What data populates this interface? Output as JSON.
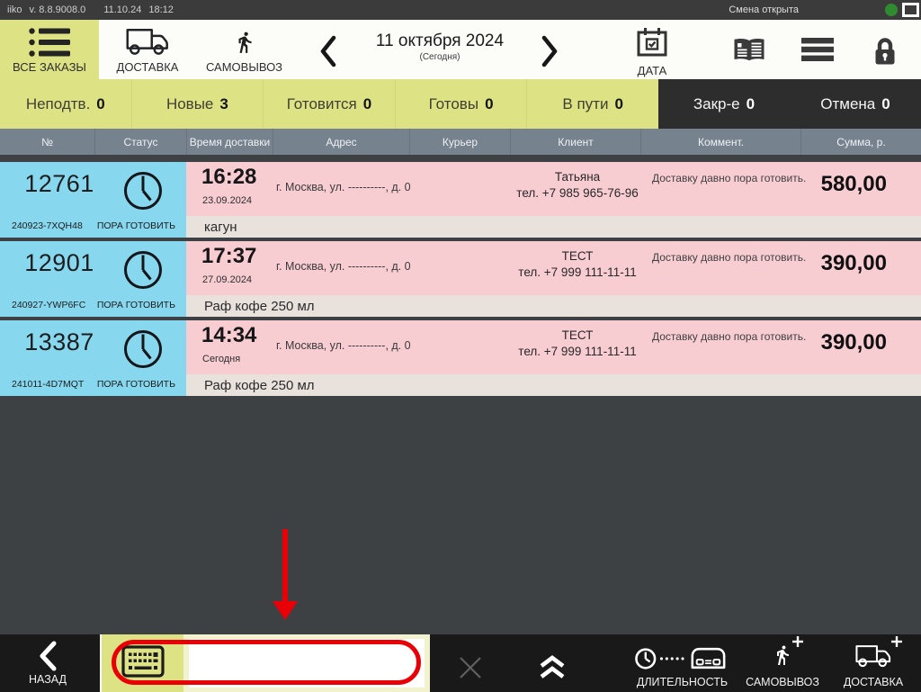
{
  "window": {
    "app": "iiko",
    "version": "v. 8.8.9008.0",
    "date": "11.10.24",
    "time": "18:12",
    "shift_status": "Смена открыта"
  },
  "toolbar": {
    "all_orders": "ВСЕ ЗАКАЗЫ",
    "delivery": "ДОСТАВКА",
    "pickup": "САМОВЫВОЗ",
    "date_title": "11 октября 2024",
    "date_subtitle": "(Сегодня)",
    "date_button": "ДАТА"
  },
  "filters": {
    "unconfirmed_label": "Неподтв.",
    "unconfirmed_count": "0",
    "new_label": "Новые",
    "new_count": "3",
    "preparing_label": "Готовится",
    "preparing_count": "0",
    "ready_label": "Готовы",
    "ready_count": "0",
    "on_way_label": "В пути",
    "on_way_count": "0",
    "closed_label": "Закр-е",
    "closed_count": "0",
    "cancelled_label": "Отмена",
    "cancelled_count": "0"
  },
  "table": {
    "col_number": "№",
    "col_status": "Статус",
    "col_delivery_time": "Время доставки",
    "col_address": "Адрес",
    "col_courier": "Курьер",
    "col_client": "Клиент",
    "col_comment": "Коммент.",
    "col_sum": "Сумма, р."
  },
  "orders": [
    {
      "number": "12761",
      "code": "240923-7XQH48",
      "status": "ПОРА ГОТОВИТЬ",
      "time": "16:28",
      "date": "23.09.2024",
      "address": "г. Москва, ул. ----------, д. 0",
      "client_name": "Татьяна",
      "client_phone": "тел. +7 985 965-76-96",
      "comment": "Доставку давно пора готовить.",
      "sum": "580,00",
      "items": "кагун"
    },
    {
      "number": "12901",
      "code": "240927-YWP6FC",
      "status": "ПОРА ГОТОВИТЬ",
      "time": "17:37",
      "date": "27.09.2024",
      "address": "г. Москва, ул. ----------, д. 0",
      "client_name": "ТЕСТ",
      "client_phone": "тел. +7 999 111-11-11",
      "comment": "Доставку давно пора готовить.",
      "sum": "390,00",
      "items": "Раф  кофе 250 мл"
    },
    {
      "number": "13387",
      "code": "241011-4D7MQT",
      "status": "ПОРА ГОТОВИТЬ",
      "time": "14:34",
      "date": "Сегодня",
      "address": "г. Москва, ул. ----------, д. 0",
      "client_name": "ТЕСТ",
      "client_phone": "тел. +7 999 111-11-11",
      "comment": "Доставку давно пора готовить.",
      "sum": "390,00",
      "items": "Раф  кофе 250 мл"
    }
  ],
  "bottom_bar": {
    "back": "НАЗАД",
    "search_value": "",
    "search_placeholder": "",
    "duration": "ДЛИТЕЛЬНОСТЬ",
    "pickup_new": "САМОВЫВОЗ",
    "delivery_new": "ДОСТАВКА"
  },
  "colors": {
    "accent_yellow": "#dde284",
    "row_number_bg": "#87d8ee",
    "row_main_bg": "#f8cdd2",
    "row_sub_bg": "#e8e1dc",
    "table_header_bg": "#76828e",
    "annotation_red": "#e80006",
    "shift_open_green": "#2f8b2f"
  }
}
